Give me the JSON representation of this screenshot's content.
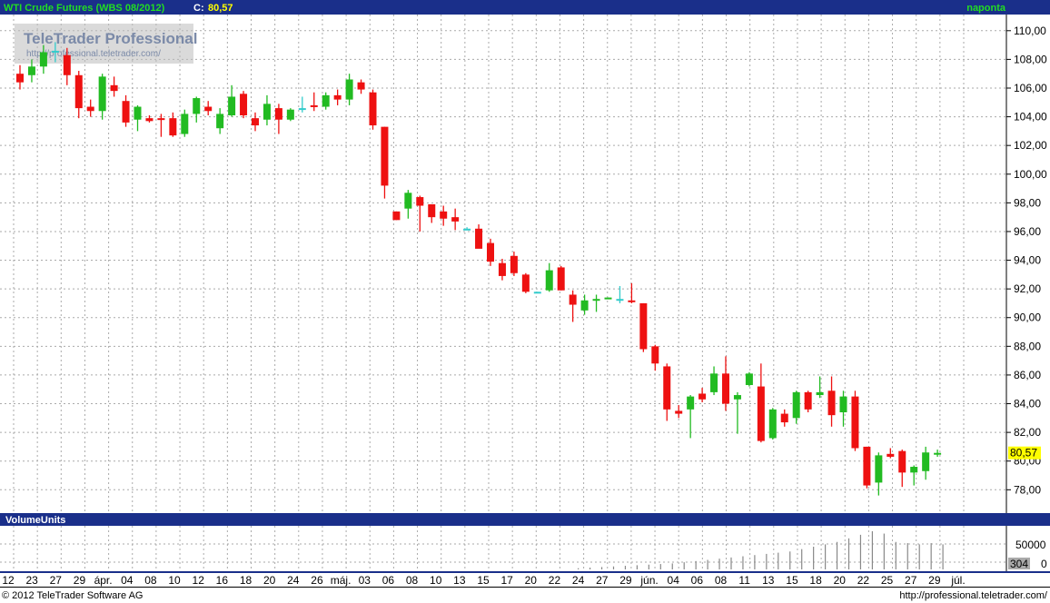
{
  "header": {
    "instrument": "WTI Crude Futures (WBS 08/2012)",
    "close_label": "C:",
    "close_value": "80,57",
    "period": "naponta"
  },
  "watermark": {
    "brand": "TeleTrader Professional",
    "url": "http://professional.teletrader.com/"
  },
  "volume_panel": {
    "title": "VolumeUnits",
    "tick_label": "50000",
    "last_value": "304",
    "zero_label": "0"
  },
  "footer": {
    "copyright": "© 2012 TeleTrader Software AG",
    "url": "http://professional.teletrader.com/"
  },
  "colors": {
    "header_bg": "#1a2f8a",
    "header_text": "#ffffff",
    "close_text": "#ffff00",
    "period_text": "#22dd22",
    "up": "#22bb22",
    "down": "#ee1111",
    "doji": "#33cccc",
    "grid": "#aaaaaa",
    "last_price_bg": "#ffff00",
    "volume_bar": "#888888"
  },
  "chart_data": {
    "type": "candlestick",
    "ylim": [
      76.5,
      111
    ],
    "yticks": [
      "78,00",
      "80,00",
      "82,00",
      "84,00",
      "86,00",
      "88,00",
      "90,00",
      "92,00",
      "94,00",
      "96,00",
      "98,00",
      "100,00",
      "102,00",
      "104,00",
      "106,00",
      "108,00",
      "110,00"
    ],
    "ytick_values": [
      78,
      80,
      82,
      84,
      86,
      88,
      90,
      92,
      94,
      96,
      98,
      100,
      102,
      104,
      106,
      108,
      110
    ],
    "last_price_label": "80,57",
    "last_price": 80.57,
    "x_labels": [
      "12",
      "23",
      "27",
      "29",
      "ápr.",
      "04",
      "08",
      "10",
      "12",
      "16",
      "18",
      "20",
      "24",
      "26",
      "máj.",
      "03",
      "06",
      "08",
      "10",
      "13",
      "15",
      "17",
      "20",
      "22",
      "24",
      "27",
      "29",
      "jún.",
      "04",
      "06",
      "08",
      "11",
      "13",
      "15",
      "18",
      "20",
      "22",
      "25",
      "27",
      "29",
      "júl."
    ],
    "candles": [
      {
        "o": 107.0,
        "h": 107.6,
        "l": 105.9,
        "c": 106.4
      },
      {
        "o": 106.9,
        "h": 108.0,
        "l": 106.4,
        "c": 107.5
      },
      {
        "o": 107.5,
        "h": 109.0,
        "l": 107.0,
        "c": 108.5
      },
      {
        "o": 108.6,
        "h": 109.2,
        "l": 107.8,
        "c": 108.6
      },
      {
        "o": 108.3,
        "h": 108.8,
        "l": 106.2,
        "c": 106.9
      },
      {
        "o": 106.9,
        "h": 107.2,
        "l": 103.9,
        "c": 104.6
      },
      {
        "o": 104.7,
        "h": 105.2,
        "l": 104.0,
        "c": 104.4
      },
      {
        "o": 104.4,
        "h": 107.0,
        "l": 103.8,
        "c": 106.8
      },
      {
        "o": 106.2,
        "h": 106.8,
        "l": 105.4,
        "c": 105.8
      },
      {
        "o": 105.1,
        "h": 105.5,
        "l": 103.3,
        "c": 103.6
      },
      {
        "o": 103.8,
        "h": 104.8,
        "l": 103.0,
        "c": 104.7
      },
      {
        "o": 103.9,
        "h": 104.1,
        "l": 103.6,
        "c": 103.7
      },
      {
        "o": 103.9,
        "h": 104.2,
        "l": 102.6,
        "c": 103.8
      },
      {
        "o": 103.9,
        "h": 104.3,
        "l": 102.6,
        "c": 102.7
      },
      {
        "o": 102.8,
        "h": 104.5,
        "l": 102.6,
        "c": 104.2
      },
      {
        "o": 104.2,
        "h": 105.4,
        "l": 103.6,
        "c": 105.3
      },
      {
        "o": 104.7,
        "h": 105.1,
        "l": 104.1,
        "c": 104.4
      },
      {
        "o": 103.2,
        "h": 104.6,
        "l": 102.8,
        "c": 104.2
      },
      {
        "o": 104.1,
        "h": 106.2,
        "l": 104.0,
        "c": 105.4
      },
      {
        "o": 105.6,
        "h": 105.8,
        "l": 103.9,
        "c": 104.1
      },
      {
        "o": 103.9,
        "h": 104.3,
        "l": 103.0,
        "c": 103.4
      },
      {
        "o": 103.8,
        "h": 105.5,
        "l": 103.4,
        "c": 104.9
      },
      {
        "o": 104.6,
        "h": 104.9,
        "l": 102.8,
        "c": 103.8
      },
      {
        "o": 103.8,
        "h": 104.6,
        "l": 103.7,
        "c": 104.5
      },
      {
        "o": 104.6,
        "h": 105.4,
        "l": 104.3,
        "c": 104.6
      },
      {
        "o": 104.8,
        "h": 105.7,
        "l": 104.4,
        "c": 104.7
      },
      {
        "o": 104.7,
        "h": 105.7,
        "l": 104.5,
        "c": 105.5
      },
      {
        "o": 105.5,
        "h": 105.9,
        "l": 104.8,
        "c": 105.2
      },
      {
        "o": 105.2,
        "h": 107.0,
        "l": 104.8,
        "c": 106.6
      },
      {
        "o": 106.4,
        "h": 106.6,
        "l": 105.6,
        "c": 105.9
      },
      {
        "o": 105.7,
        "h": 105.9,
        "l": 103.1,
        "c": 103.4
      },
      {
        "o": 103.3,
        "h": 103.3,
        "l": 98.3,
        "c": 99.2
      },
      {
        "o": 97.4,
        "h": 97.4,
        "l": 96.8,
        "c": 96.8
      },
      {
        "o": 97.6,
        "h": 98.9,
        "l": 96.9,
        "c": 98.7
      },
      {
        "o": 98.4,
        "h": 98.5,
        "l": 96.0,
        "c": 97.8
      },
      {
        "o": 97.9,
        "h": 97.9,
        "l": 96.6,
        "c": 97.0
      },
      {
        "o": 97.4,
        "h": 97.8,
        "l": 96.4,
        "c": 96.9
      },
      {
        "o": 97.0,
        "h": 97.6,
        "l": 96.1,
        "c": 96.7
      },
      {
        "o": 96.2,
        "h": 96.3,
        "l": 96.1,
        "c": 96.2
      },
      {
        "o": 96.2,
        "h": 96.5,
        "l": 94.9,
        "c": 94.8
      },
      {
        "o": 95.2,
        "h": 95.5,
        "l": 93.6,
        "c": 93.9
      },
      {
        "o": 93.8,
        "h": 94.1,
        "l": 92.6,
        "c": 92.9
      },
      {
        "o": 94.3,
        "h": 94.6,
        "l": 92.9,
        "c": 93.1
      },
      {
        "o": 93.0,
        "h": 93.1,
        "l": 91.7,
        "c": 91.8
      },
      {
        "o": 91.8,
        "h": 91.8,
        "l": 91.7,
        "c": 91.8
      },
      {
        "o": 91.9,
        "h": 93.8,
        "l": 91.8,
        "c": 93.3
      },
      {
        "o": 93.5,
        "h": 93.6,
        "l": 91.9,
        "c": 91.9
      },
      {
        "o": 91.6,
        "h": 91.9,
        "l": 89.7,
        "c": 90.9
      },
      {
        "o": 90.5,
        "h": 91.6,
        "l": 90.2,
        "c": 91.2
      },
      {
        "o": 91.2,
        "h": 91.6,
        "l": 90.4,
        "c": 91.3
      },
      {
        "o": 91.3,
        "h": 91.4,
        "l": 91.3,
        "c": 91.4
      },
      {
        "o": 91.3,
        "h": 92.2,
        "l": 91.0,
        "c": 91.3
      },
      {
        "o": 91.2,
        "h": 92.4,
        "l": 91.0,
        "c": 91.1
      },
      {
        "o": 91.0,
        "h": 91.0,
        "l": 87.6,
        "c": 87.8
      },
      {
        "o": 88.0,
        "h": 88.1,
        "l": 86.3,
        "c": 86.8
      },
      {
        "o": 86.6,
        "h": 86.8,
        "l": 82.8,
        "c": 83.6
      },
      {
        "o": 83.5,
        "h": 83.9,
        "l": 83.0,
        "c": 83.3
      },
      {
        "o": 83.6,
        "h": 84.6,
        "l": 81.6,
        "c": 84.5
      },
      {
        "o": 84.7,
        "h": 85.1,
        "l": 84.1,
        "c": 84.3
      },
      {
        "o": 84.8,
        "h": 86.6,
        "l": 84.6,
        "c": 86.1
      },
      {
        "o": 86.1,
        "h": 87.3,
        "l": 83.5,
        "c": 84.0
      },
      {
        "o": 84.3,
        "h": 84.8,
        "l": 81.9,
        "c": 84.6
      },
      {
        "o": 85.3,
        "h": 86.2,
        "l": 85.2,
        "c": 86.1
      },
      {
        "o": 85.2,
        "h": 86.8,
        "l": 81.3,
        "c": 81.4
      },
      {
        "o": 81.6,
        "h": 83.7,
        "l": 81.5,
        "c": 83.6
      },
      {
        "o": 83.3,
        "h": 83.6,
        "l": 82.4,
        "c": 82.7
      },
      {
        "o": 83.0,
        "h": 84.9,
        "l": 82.6,
        "c": 84.8
      },
      {
        "o": 84.8,
        "h": 84.9,
        "l": 83.4,
        "c": 83.6
      },
      {
        "o": 84.6,
        "h": 85.9,
        "l": 84.4,
        "c": 84.8
      },
      {
        "o": 84.9,
        "h": 85.9,
        "l": 82.4,
        "c": 83.2
      },
      {
        "o": 83.4,
        "h": 84.9,
        "l": 82.4,
        "c": 84.5
      },
      {
        "o": 84.5,
        "h": 84.9,
        "l": 80.7,
        "c": 80.9
      },
      {
        "o": 81.0,
        "h": 81.0,
        "l": 78.1,
        "c": 78.3
      },
      {
        "o": 78.5,
        "h": 80.6,
        "l": 77.6,
        "c": 80.4
      },
      {
        "o": 80.5,
        "h": 80.9,
        "l": 80.2,
        "c": 80.3
      },
      {
        "o": 80.7,
        "h": 80.8,
        "l": 78.2,
        "c": 79.2
      },
      {
        "o": 79.2,
        "h": 79.7,
        "l": 78.3,
        "c": 79.6
      },
      {
        "o": 79.3,
        "h": 81.0,
        "l": 78.7,
        "c": 80.6
      },
      {
        "o": 80.5,
        "h": 80.8,
        "l": 80.3,
        "c": 80.57
      }
    ],
    "volume": [
      0,
      0,
      0,
      0,
      0,
      0,
      0,
      0,
      0,
      0,
      0,
      0,
      0,
      0,
      0,
      0,
      0,
      0,
      0,
      0,
      0,
      0,
      0,
      0,
      0,
      0,
      0,
      0,
      0,
      0,
      0,
      0,
      0,
      0,
      0,
      0,
      0,
      0,
      0,
      0,
      0,
      0,
      0,
      0,
      0,
      0,
      0,
      0,
      0,
      0,
      0,
      0,
      0,
      0,
      0,
      0,
      0,
      0,
      0,
      0,
      0,
      0,
      0,
      0,
      0,
      0,
      0,
      0,
      0,
      0,
      0,
      0,
      0,
      0,
      0,
      0,
      0,
      0,
      304
    ],
    "volume_bars": [
      2000,
      3000,
      4000,
      5000,
      6000,
      7000,
      8000,
      9000,
      10000,
      12000,
      14000,
      16000,
      18000,
      20000,
      22000,
      24000,
      26000,
      28000,
      30000,
      34000,
      38000,
      42000,
      46000,
      52000,
      58000,
      64000,
      60000,
      46000,
      44000,
      42000,
      44000,
      42000
    ],
    "volume_ylim": [
      0,
      70000
    ],
    "grid": true
  }
}
